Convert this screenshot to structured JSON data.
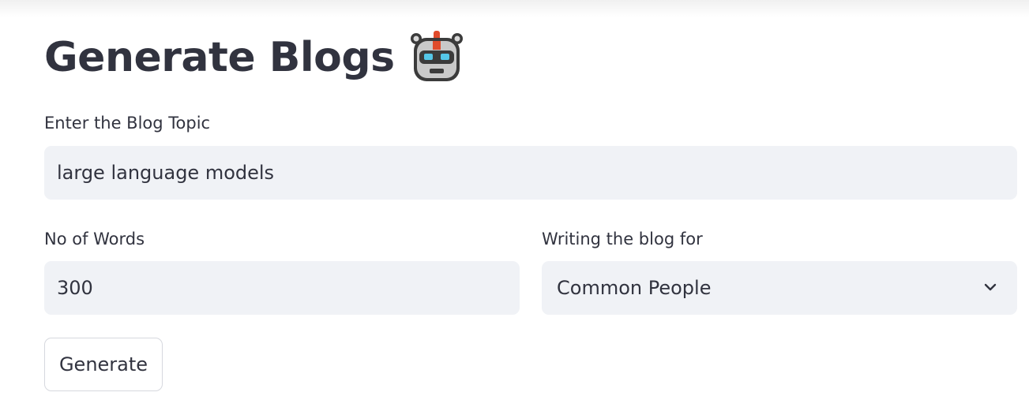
{
  "page": {
    "title": "Generate Blogs",
    "title_icon": "robot-emoji"
  },
  "form": {
    "topic": {
      "label": "Enter the Blog Topic",
      "value": "large language models"
    },
    "words": {
      "label": "No of Words",
      "value": "300"
    },
    "audience": {
      "label": "Writing the blog for",
      "selected": "Common People",
      "icon": "chevron-down-icon"
    },
    "generate_label": "Generate"
  },
  "colors": {
    "input_bg": "#f0f2f6",
    "text": "#31333f",
    "button_border": "#d6d8de"
  }
}
